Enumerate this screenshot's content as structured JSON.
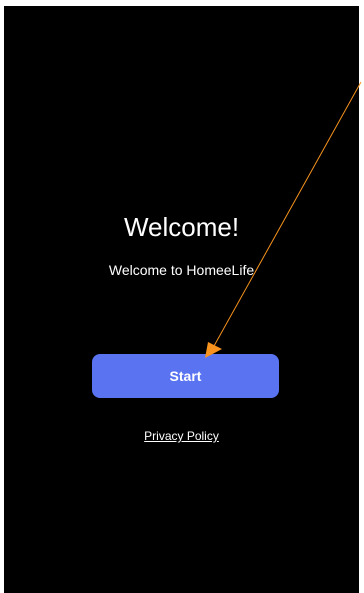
{
  "screen": {
    "title": "Welcome!",
    "subtitle": "Welcome to HomeeLife",
    "start_label": "Start",
    "privacy_label": "Privacy Policy"
  },
  "colors": {
    "background": "#000000",
    "button": "#5a73f0",
    "text": "#ffffff",
    "pointer": "#f7931e"
  }
}
